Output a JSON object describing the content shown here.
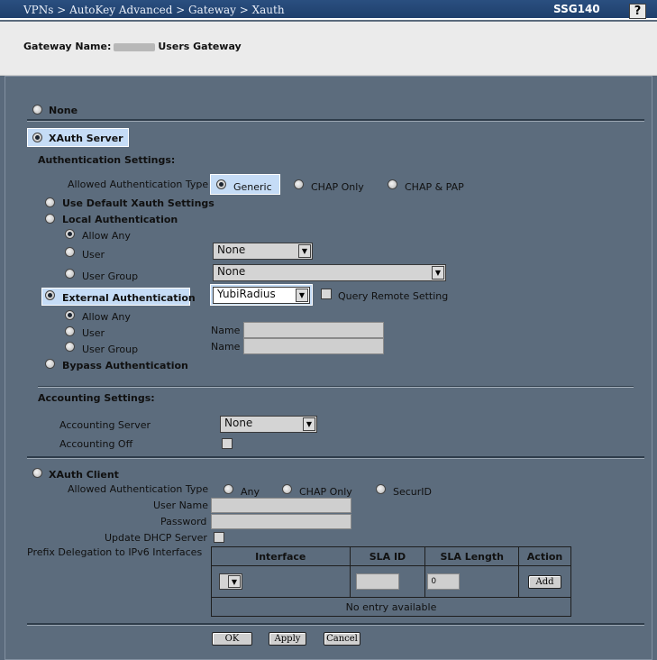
{
  "header": {
    "breadcrumb": "VPNs > AutoKey Advanced > Gateway > Xauth",
    "model": "SSG140",
    "help": "?",
    "gateway_label": "Gateway Name:",
    "gateway_name": "Users Gateway"
  },
  "mode": {
    "none_label": "None",
    "server_label": "XAuth Server",
    "client_label": "XAuth Client",
    "selected": "XAuth Server"
  },
  "auth": {
    "title": "Authentication Settings:",
    "allowed_type_label": "Allowed Authentication Type",
    "types": [
      "Generic",
      "CHAP Only",
      "CHAP & PAP"
    ],
    "selected_type": "Generic",
    "use_default": "Use Default Xauth Settings",
    "local": {
      "label": "Local Authentication",
      "allow_any": "Allow Any",
      "user": "User",
      "user_group": "User Group",
      "user_select": "None",
      "group_select": "None"
    },
    "external": {
      "label": "External Authentication",
      "server_select": "YubiRadius",
      "query_remote": "Query Remote Setting",
      "allow_any": "Allow Any",
      "user": "User",
      "user_group": "User Group",
      "name_label": "Name",
      "name_label_2": "Name"
    },
    "bypass": "Bypass Authentication"
  },
  "accounting": {
    "title": "Accounting Settings:",
    "server_label": "Accounting Server",
    "server_select": "None",
    "off_label": "Accounting Off"
  },
  "client": {
    "allowed_type_label": "Allowed Authentication Type",
    "types": [
      "Any",
      "CHAP Only",
      "SecurID"
    ],
    "user_name_label": "User Name",
    "password_label": "Password",
    "dhcp_label": "Update DHCP Server",
    "prefix_label": "Prefix Delegation to IPv6 Interfaces",
    "table": {
      "headers": [
        "Interface",
        "SLA ID",
        "SLA Length",
        "Action"
      ],
      "sla_length_value": "0",
      "add_label": "Add",
      "empty": "No entry available"
    }
  },
  "buttons": {
    "ok": "OK",
    "apply": "Apply",
    "cancel": "Cancel"
  },
  "colors": {
    "title_bar": "#1f3f6c",
    "highlight": "#c5dcf6",
    "panel": "#5c6c7d"
  }
}
